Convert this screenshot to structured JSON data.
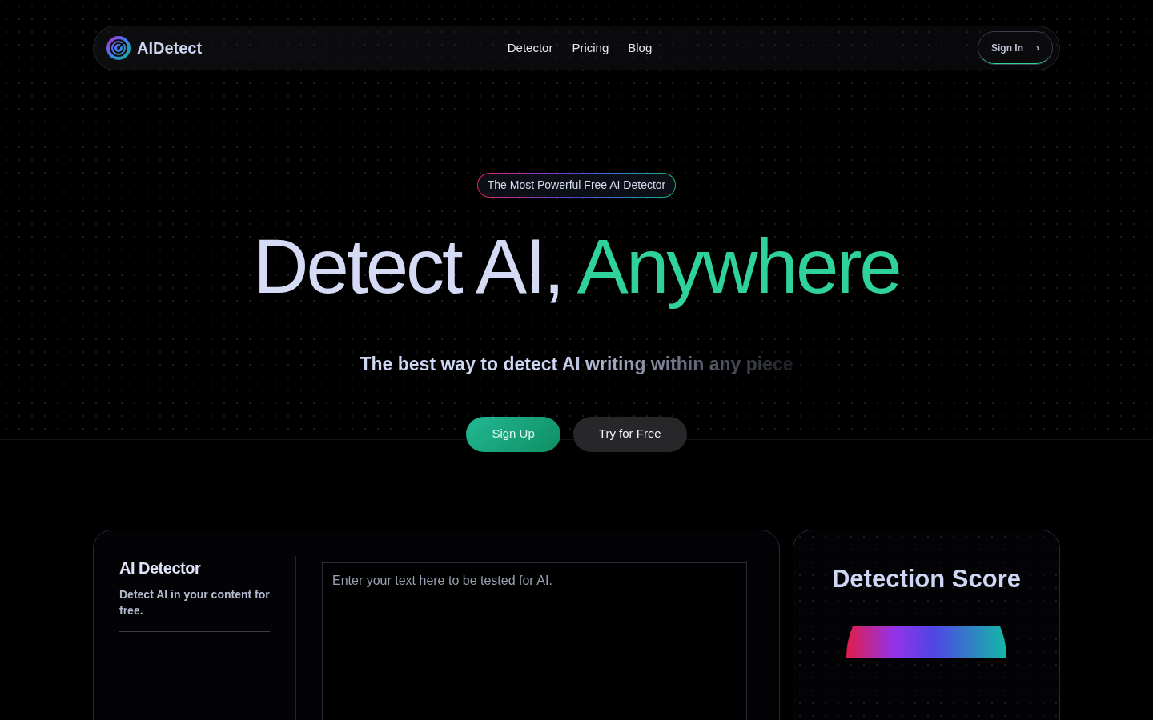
{
  "navbar": {
    "brand": "AIDetect",
    "links": [
      {
        "label": "Detector"
      },
      {
        "label": "Pricing"
      },
      {
        "label": "Blog"
      }
    ],
    "sign_in": {
      "label": "Sign In",
      "chevron": "›"
    }
  },
  "hero": {
    "badge": "The Most Powerful Free AI Detector",
    "headline": {
      "lead": "Detect AI, ",
      "highlight": "Anywhere"
    },
    "subtitle": "The best way to detect AI writing within any piece",
    "buttons": [
      {
        "label": "Sign Up",
        "kind": "primary"
      },
      {
        "label": "Try for Free",
        "kind": "secondary"
      }
    ]
  },
  "detector": {
    "title": "AI Detector",
    "description": "Detect AI in your content for free.",
    "input": {
      "placeholder": "Enter your text here to be tested for AI."
    }
  },
  "score": {
    "title": "Detection Score"
  }
}
